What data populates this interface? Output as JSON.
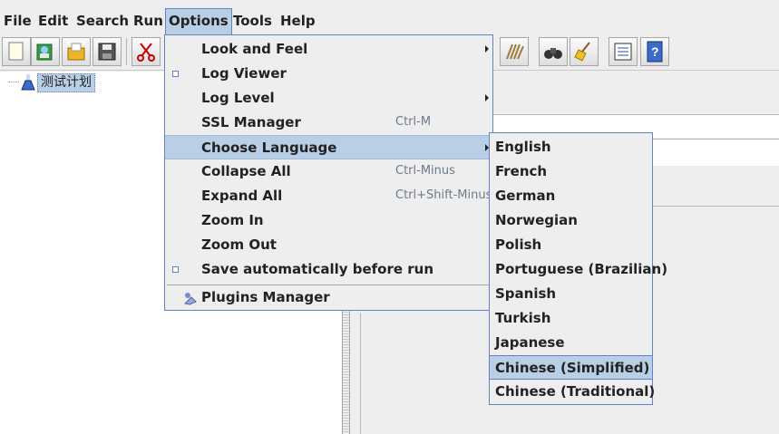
{
  "menubar": {
    "items": [
      {
        "label": "File",
        "key": "F"
      },
      {
        "label": "Edit",
        "key": "E"
      },
      {
        "label": "Search",
        "key": "S"
      },
      {
        "label": "Run",
        "key": "R"
      },
      {
        "label": "Options",
        "key": "O"
      },
      {
        "label": "Tools",
        "key": "T"
      },
      {
        "label": "Help",
        "key": "H"
      }
    ],
    "active": "Options"
  },
  "toolbar": {
    "icons": [
      "new-icon",
      "templates-icon",
      "open-icon",
      "save-icon",
      "cut-icon",
      "clear-all-icon",
      "binoculars-icon",
      "broom-icon",
      "function-helper-icon",
      "help-icon"
    ]
  },
  "tree": {
    "root_label": "测试计划"
  },
  "options_menu": {
    "items": [
      {
        "label": "Look and Feel",
        "mnemonic": "L",
        "accel": "",
        "submenu": true,
        "check": false
      },
      {
        "label": "Log Viewer",
        "mnemonic": "",
        "accel": "",
        "submenu": false,
        "check": true
      },
      {
        "label": "Log Level",
        "mnemonic": "",
        "accel": "",
        "submenu": true,
        "check": false
      },
      {
        "label": "SSL Manager",
        "mnemonic": "S",
        "accel": "Ctrl-M",
        "submenu": false,
        "check": false
      },
      {
        "label": "Choose Language",
        "mnemonic": "C",
        "accel": "",
        "submenu": true,
        "check": false
      },
      {
        "label": "Collapse All",
        "mnemonic": "",
        "accel": "Ctrl-Minus",
        "submenu": false,
        "check": false
      },
      {
        "label": "Expand All",
        "mnemonic": "",
        "accel": "Ctrl+Shift-Minus",
        "submenu": false,
        "check": false
      },
      {
        "label": "Zoom In",
        "mnemonic": "",
        "accel": "",
        "submenu": false,
        "check": false
      },
      {
        "label": "Zoom Out",
        "mnemonic": "",
        "accel": "",
        "submenu": false,
        "check": false
      },
      {
        "label": "Save automatically before run",
        "mnemonic": "",
        "accel": "",
        "submenu": false,
        "check": true
      }
    ],
    "plugins_label": "Plugins Manager",
    "selected": "Choose Language"
  },
  "language_menu": {
    "items": [
      "English",
      "French",
      "German",
      "Norwegian",
      "Polish",
      "Portuguese (Brazilian)",
      "Spanish",
      "Turkish",
      "Japanese",
      "Chinese (Simplified)",
      "Chinese (Traditional)"
    ],
    "selected": "Chinese (Simplified)"
  },
  "colors": {
    "selection": "#b8cfe5",
    "border": "#6382bf",
    "background": "#eeeeee"
  }
}
